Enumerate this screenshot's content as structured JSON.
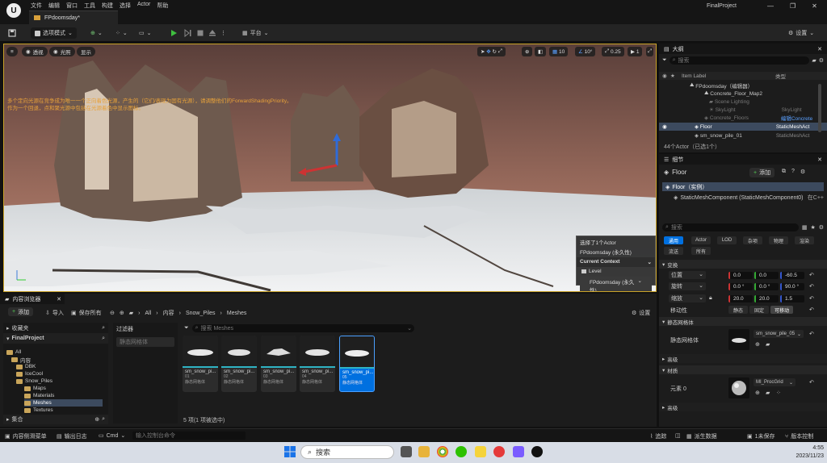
{
  "menu": {
    "items": [
      "文件",
      "编辑",
      "窗口",
      "工具",
      "构建",
      "选择",
      "Actor",
      "帮助"
    ]
  },
  "doc_tab": {
    "label": "FPdoomsday*"
  },
  "project": {
    "name": "FinalProject"
  },
  "toolbar": {
    "mode": "选项模式",
    "platform": "平台",
    "settings": "设置"
  },
  "viewport": {
    "view_buttons": [
      "透视",
      "光照",
      "显示"
    ],
    "grid_size": "10",
    "rot_snap": "10°",
    "scale_snap": "0.25",
    "cam_speed": "1",
    "warning_line1": "多个定向光源在竞争成为唯一一个正向着色光源，产生的（它们/表现为固有光源），请调整他们的ForwardShadingPriority。",
    "warning_line2": "作为一个回退，点和聚光源中包括在光源着色中显示图标。",
    "sel_title": "选择了1个Actor",
    "sel_level": "FPdoomsday (永久性)",
    "current_context": "Current Context",
    "level_label": "Level",
    "level_value": "FPdoomsday (永久性)"
  },
  "outliner": {
    "tab": "大纲",
    "search_placeholder": "搜索",
    "col_label": "Item Label",
    "col_type": "类型",
    "rows": [
      {
        "name": "FPdoomsday（编辑器）",
        "type": ""
      },
      {
        "name": "Concrete_Floor_Map2",
        "type": ""
      },
      {
        "name": "Scene Lighting",
        "type": ""
      },
      {
        "name": "SkyLight",
        "type": "SkyLight"
      },
      {
        "name": "Concrete_Floors",
        "type": "编辑Concrete"
      },
      {
        "name": "Floor",
        "type": "StaticMeshAct"
      },
      {
        "name": "sm_snow_pile_01",
        "type": "StaticMeshAct"
      }
    ],
    "count": "44个Actor（已选1个）"
  },
  "details": {
    "tab": "细节",
    "actor_name": "Floor",
    "add_label": "添加",
    "instance_label": "Floor（实例）",
    "component_label": "StaticMeshComponent (StaticMeshComponent0)",
    "component_link": "在C++",
    "search_placeholder": "搜索",
    "filters": [
      "通用",
      "Actor",
      "LOD",
      "杂项",
      "物理",
      "渲染",
      "流送",
      "所有"
    ],
    "transform_header": "变换",
    "location_label": "位置",
    "rotation_label": "旋转",
    "scale_label": "缩放",
    "location": [
      "0.0",
      "0.0",
      "-60.5"
    ],
    "rotation": [
      "0.0 °",
      "0.0 °",
      "90.0 °"
    ],
    "scale": [
      "20.0",
      "20.0",
      "1.5"
    ],
    "mobility_label": "移动性",
    "mobility": [
      "静态",
      "固定",
      "可移动"
    ],
    "static_mesh_header": "静态网格体",
    "static_mesh_label": "静态网格体",
    "static_mesh_value": "sm_snow_pile_05",
    "advanced_label": "高级",
    "materials_header": "材质",
    "element_label": "元素 0",
    "material_value": "MI_ProcGrid",
    "advanced2_label": "高级"
  },
  "content_browser": {
    "tab": "内容浏览器",
    "add_label": "添加",
    "import_label": "导入",
    "save_all_label": "保存所有",
    "path": [
      "All",
      "内容",
      "Snow_Piles",
      "Meshes"
    ],
    "settings_label": "设置",
    "favorites_label": "收藏夹",
    "project_label": "FinalProject",
    "tree": [
      {
        "name": "All",
        "level": 0
      },
      {
        "name": "内容",
        "level": 1
      },
      {
        "name": "DBK",
        "level": 2
      },
      {
        "name": "IceCool",
        "level": 2
      },
      {
        "name": "Snow_Piles",
        "level": 2
      },
      {
        "name": "Maps",
        "level": 3
      },
      {
        "name": "Materials",
        "level": 3
      },
      {
        "name": "Meshes",
        "level": 3
      },
      {
        "name": "Textures",
        "level": 3
      }
    ],
    "collections_label": "集合",
    "filters_label": "过滤器",
    "filter_placeholder": "静态网格体",
    "search_placeholder": "搜索 Meshes",
    "tiles": [
      {
        "name": "sm_snow_pi...",
        "num": "01",
        "type": "静态网格体"
      },
      {
        "name": "sm_snow_pi...",
        "num": "02",
        "type": "静态网格体"
      },
      {
        "name": "sm_snow_pi...",
        "num": "03",
        "type": "静态网格体"
      },
      {
        "name": "sm_snow_pi...",
        "num": "04",
        "type": "静态网格体"
      },
      {
        "name": "sm_snow_pi...",
        "num": "05",
        "type": "静态网格体"
      }
    ],
    "count": "5 项(1 项被选中)"
  },
  "statusbar": {
    "drawer": "内容侧滑菜单",
    "output_log": "输出日志",
    "cmd": "Cmd",
    "cmd_placeholder": "输入控制台命令",
    "trace": "追踪",
    "derived": "派生数据",
    "unsaved": "1未保存",
    "source_control": "版本控制"
  },
  "taskbar": {
    "search": "搜索",
    "time": "4:55",
    "date": "2023/11/23"
  },
  "colors": {
    "accent": "#0070e0",
    "viewport_border": "#c9a227",
    "warning": "#e8a23a"
  }
}
